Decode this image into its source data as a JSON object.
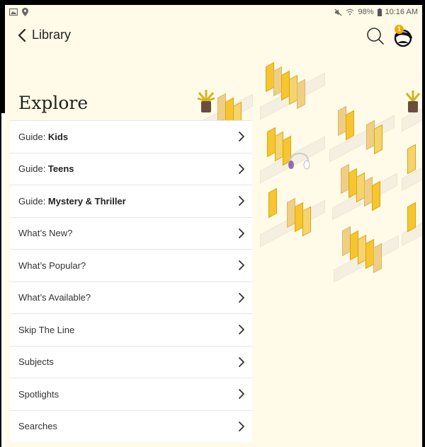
{
  "status_bar": {
    "left_icons": [
      "image-icon",
      "location-icon"
    ],
    "battery": "98%",
    "time": "10:16 AM",
    "right_icons": [
      "mute-icon",
      "wifi-icon",
      "battery-icon"
    ]
  },
  "header": {
    "back_label": "Library",
    "notification_count": "1"
  },
  "page_title": "Explore",
  "menu": [
    {
      "prefix": "Guide: ",
      "bold": "Kids",
      "text": ""
    },
    {
      "prefix": "Guide: ",
      "bold": "Teens",
      "text": ""
    },
    {
      "prefix": "Guide: ",
      "bold": "Mystery & Thriller",
      "text": ""
    },
    {
      "prefix": "",
      "bold": "",
      "text": "What’s New?"
    },
    {
      "prefix": "",
      "bold": "",
      "text": "What’s Popular?"
    },
    {
      "prefix": "",
      "bold": "",
      "text": "What’s Available?"
    },
    {
      "prefix": "",
      "bold": "",
      "text": "Skip The Line"
    },
    {
      "prefix": "",
      "bold": "",
      "text": "Subjects"
    },
    {
      "prefix": "",
      "bold": "",
      "text": "Spotlights"
    },
    {
      "prefix": "",
      "bold": "",
      "text": "Searches"
    }
  ],
  "colors": {
    "background": "#fffbe8",
    "book": "#f7c531",
    "badge": "#f2a800"
  }
}
